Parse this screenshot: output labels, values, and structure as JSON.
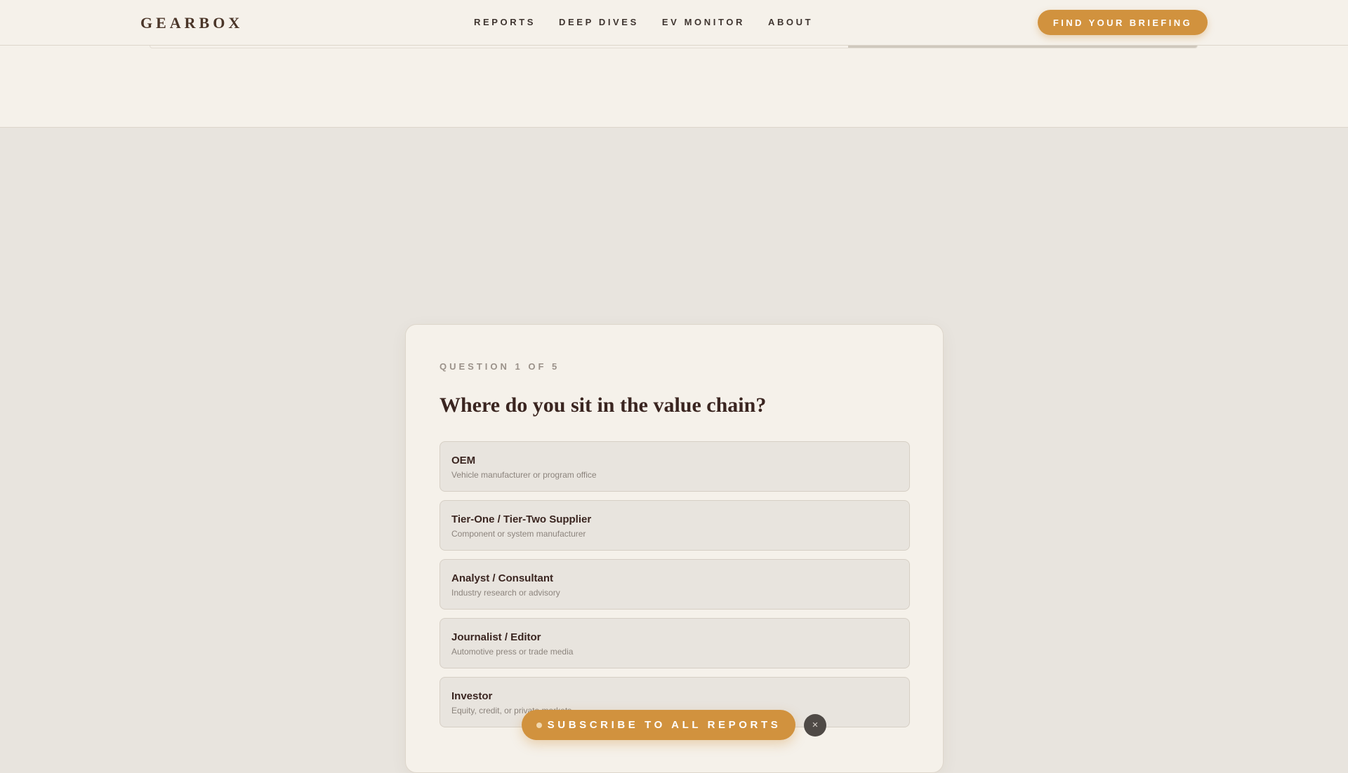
{
  "header": {
    "logo": "GEARBOX",
    "nav": [
      "REPORTS",
      "DEEP DIVES",
      "EV MONITOR",
      "ABOUT"
    ],
    "cta_label": "FIND YOUR BRIEFING"
  },
  "quiz": {
    "progress_label": "QUESTION 1 OF 5",
    "title": "Where do you sit in the value chain?",
    "options": [
      {
        "title": "OEM",
        "desc": "Vehicle manufacturer or program office"
      },
      {
        "title": "Tier-One / Tier-Two Supplier",
        "desc": "Component or system manufacturer"
      },
      {
        "title": "Analyst / Consultant",
        "desc": "Industry research or advisory"
      },
      {
        "title": "Journalist / Editor",
        "desc": "Automotive press or trade media"
      },
      {
        "title": "Investor",
        "desc": "Equity, credit, or private markets"
      }
    ]
  },
  "subscribe": {
    "label": "SUBSCRIBE TO ALL REPORTS",
    "close_icon": "×"
  },
  "colors": {
    "accent": "#d1923e",
    "page_bg": "#e8e4de",
    "surface": "#f5f1ea",
    "heading": "#3a2520"
  }
}
